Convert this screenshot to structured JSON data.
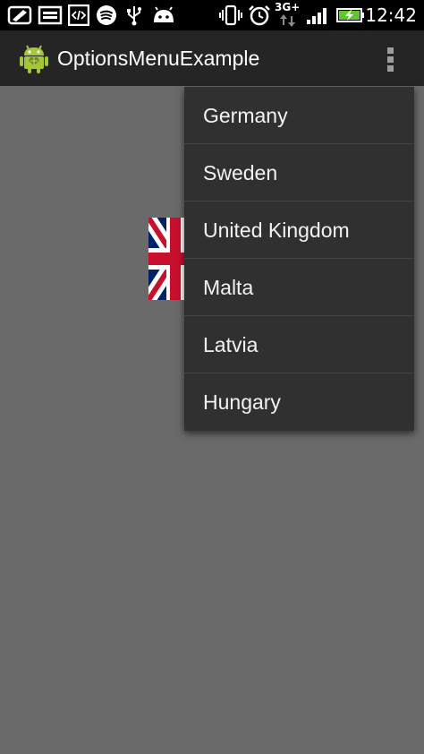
{
  "status_bar": {
    "time": "12:42",
    "network_type": "3G+",
    "icons": [
      "photo-edit-icon",
      "keyboard-icon",
      "code-icon",
      "spotify-icon",
      "usb-icon",
      "android-debug-icon",
      "vibrate-icon",
      "alarm-icon",
      "network-3g-icon",
      "signal-icon",
      "battery-charging-icon"
    ]
  },
  "action_bar": {
    "title": "OptionsMenuExample",
    "app_icon": "android-robot-icon",
    "overflow_icon": "overflow-menu-icon"
  },
  "content": {
    "image": "union-jack-flag"
  },
  "options_menu": {
    "items": [
      {
        "label": "Germany"
      },
      {
        "label": "Sweden"
      },
      {
        "label": "United Kingdom"
      },
      {
        "label": "Malta"
      },
      {
        "label": "Latvia"
      },
      {
        "label": "Hungary"
      }
    ]
  },
  "colors": {
    "background": "#6a6a6a",
    "action_bar": "#252525",
    "menu_background": "#303030",
    "menu_divider": "#444444",
    "status_bar": "#000000"
  }
}
